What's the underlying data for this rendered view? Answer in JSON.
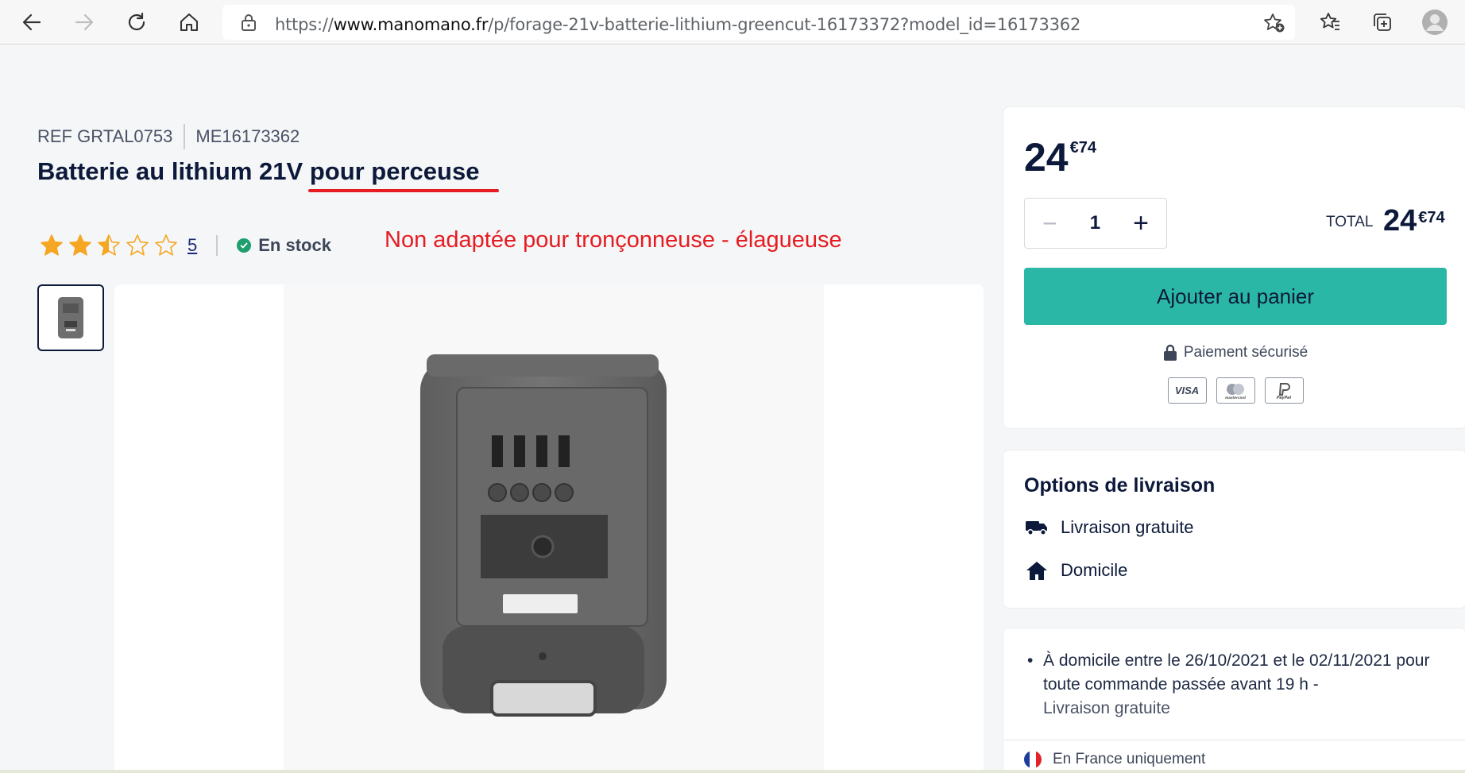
{
  "browser": {
    "url_prefix": "https://",
    "url_domain": "www.manomano.fr",
    "url_path": "/p/forage-21v-batterie-lithium-greencut-16173372?model_id=16173362",
    "icons": [
      "back-icon",
      "forward-icon",
      "reload-icon",
      "home-icon",
      "lock-icon",
      "add-favorite-icon",
      "favorites-icon",
      "collections-icon",
      "profile-icon"
    ]
  },
  "product": {
    "ref": "REF GRTAL0753",
    "me_code": "ME16173362",
    "title": "Batterie au lithium 21V pour perceuse",
    "rating_value": 2.5,
    "rating_max": 5,
    "rating_count": "5",
    "stock": "En stock",
    "annotation": "Non adaptée pour tronçonneuse - élagueuse"
  },
  "price": {
    "units": "24",
    "cents": "€74",
    "quantity": "1",
    "minus": "−",
    "plus": "+",
    "total_label": "TOTAL",
    "total_units": "24",
    "total_cents": "€74",
    "add_to_cart": "Ajouter au panier",
    "secure_payment": "Paiement sécurisé",
    "payment_methods": [
      "VISA",
      "mastercard",
      "PayPal"
    ]
  },
  "delivery": {
    "title": "Options de livraison",
    "free_delivery": "Livraison gratuite",
    "home": "Domicile",
    "info_line": "À domicile entre le 26/10/2021 et le 02/11/2021 pour toute commande passée avant 19 h -",
    "info_free": "Livraison gratuite",
    "france_only": "En France uniquement"
  },
  "colors": {
    "accent": "#2ab7a5",
    "annotation_red": "#e51c22",
    "star": "#f5a623",
    "stock_green": "#1f9e6e",
    "navy": "#0c193a"
  }
}
